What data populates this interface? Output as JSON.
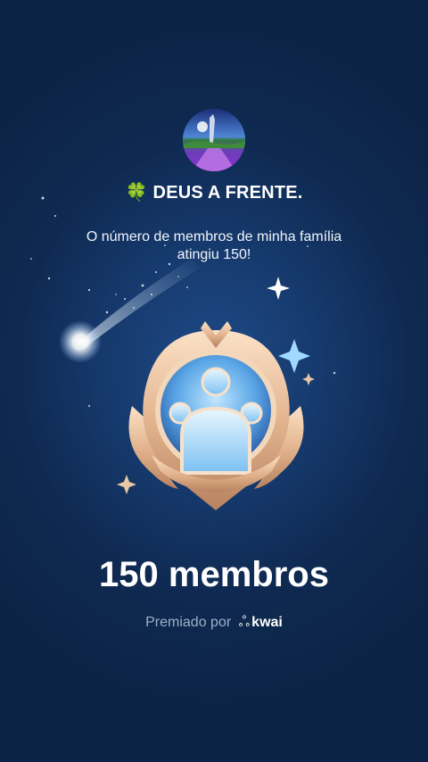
{
  "group": {
    "name": "DEUS A FRENTE.",
    "emoji": "🍀"
  },
  "message": {
    "line1": "O número de membros de minha família",
    "line2": "atingiu 150!"
  },
  "milestone": {
    "title": "150 membros"
  },
  "footer": {
    "awarded_by": "Premiado por",
    "brand": "kwai",
    "brand_icon": "kwai-logo-icon"
  },
  "colors": {
    "background": "#163a6e",
    "medal_gold": "#e3b58f",
    "medal_blue": "#6fb8ef",
    "muted_text": "#9fb0c9"
  }
}
